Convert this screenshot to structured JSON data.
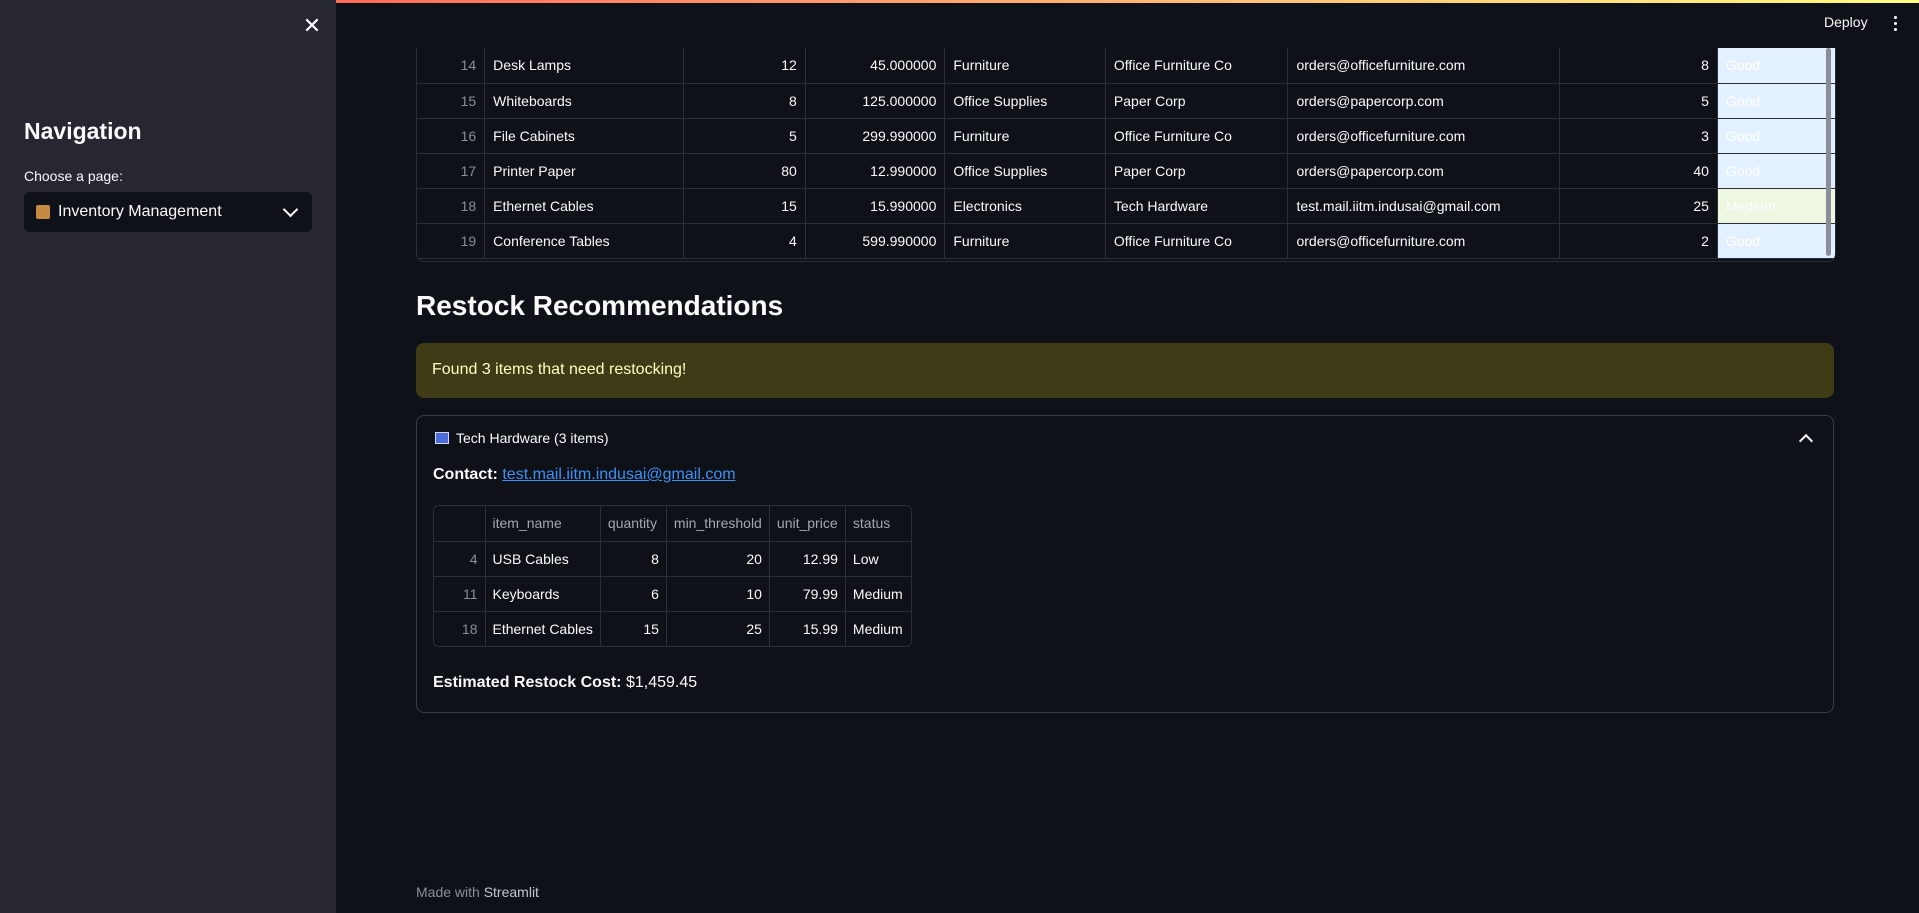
{
  "sidebar": {
    "title": "Navigation",
    "select_label": "Choose a page:",
    "selected_page": "Inventory Management"
  },
  "header": {
    "deploy_label": "Deploy"
  },
  "inventory_rows": [
    {
      "idx": "14",
      "item": "Desk Lamps",
      "qty": "12",
      "price": "45.000000",
      "category": "Furniture",
      "supplier": "Office Furniture Co",
      "email": "orders@officefurniture.com",
      "min": "8",
      "status": "Good"
    },
    {
      "idx": "15",
      "item": "Whiteboards",
      "qty": "8",
      "price": "125.000000",
      "category": "Office Supplies",
      "supplier": "Paper Corp",
      "email": "orders@papercorp.com",
      "min": "5",
      "status": "Good"
    },
    {
      "idx": "16",
      "item": "File Cabinets",
      "qty": "5",
      "price": "299.990000",
      "category": "Furniture",
      "supplier": "Office Furniture Co",
      "email": "orders@officefurniture.com",
      "min": "3",
      "status": "Good"
    },
    {
      "idx": "17",
      "item": "Printer Paper",
      "qty": "80",
      "price": "12.990000",
      "category": "Office Supplies",
      "supplier": "Paper Corp",
      "email": "orders@papercorp.com",
      "min": "40",
      "status": "Good"
    },
    {
      "idx": "18",
      "item": "Ethernet Cables",
      "qty": "15",
      "price": "15.990000",
      "category": "Electronics",
      "supplier": "Tech Hardware",
      "email": "test.mail.iitm.indusai@gmail.com",
      "min": "25",
      "status": "Medium"
    },
    {
      "idx": "19",
      "item": "Conference Tables",
      "qty": "4",
      "price": "599.990000",
      "category": "Furniture",
      "supplier": "Office Furniture Co",
      "email": "orders@officefurniture.com",
      "min": "2",
      "status": "Good"
    }
  ],
  "restock": {
    "heading": "Restock Recommendations",
    "alert": "Found 3 items that need restocking!",
    "expander_title": "Tech Hardware (3 items)",
    "contact_label": "Contact:",
    "contact_email": "test.mail.iitm.indusai@gmail.com",
    "columns": [
      "item_name",
      "quantity",
      "min_threshold",
      "unit_price",
      "status"
    ],
    "rows": [
      {
        "idx": "4",
        "item_name": "USB Cables",
        "quantity": "8",
        "min_threshold": "20",
        "unit_price": "12.99",
        "status": "Low"
      },
      {
        "idx": "11",
        "item_name": "Keyboards",
        "quantity": "6",
        "min_threshold": "10",
        "unit_price": "79.99",
        "status": "Medium"
      },
      {
        "idx": "18",
        "item_name": "Ethernet Cables",
        "quantity": "15",
        "min_threshold": "25",
        "unit_price": "15.99",
        "status": "Medium"
      }
    ],
    "cost_label": "Estimated Restock Cost:",
    "cost_value": "$1,459.45"
  },
  "footer": {
    "prefix": "Made with",
    "brand": "Streamlit"
  }
}
